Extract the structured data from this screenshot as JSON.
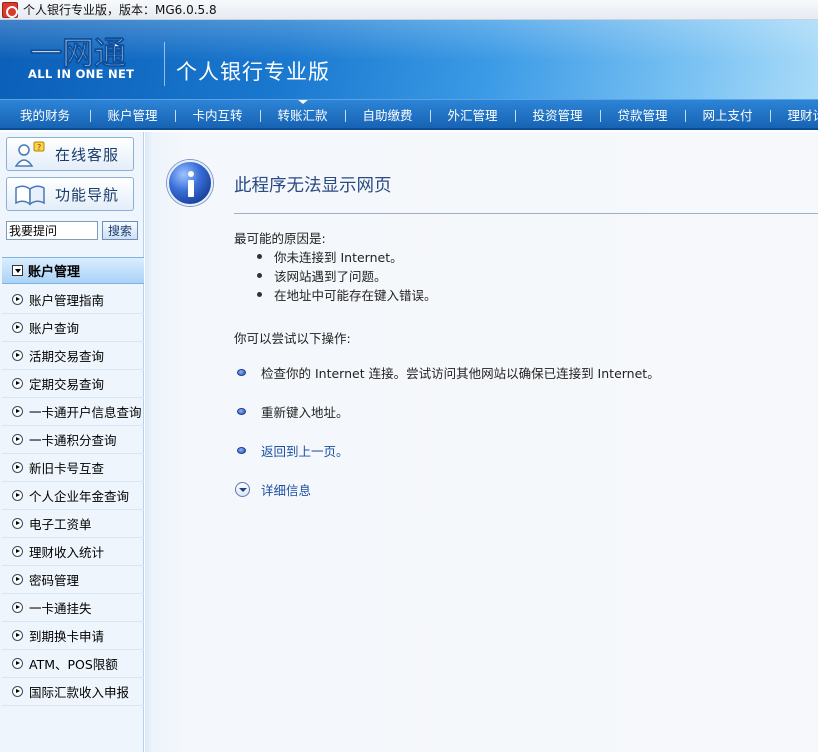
{
  "window": {
    "title": "个人银行专业版，版本：MG6.0.5.8"
  },
  "banner": {
    "logo_text": "一网通",
    "logo_sub": "ALL IN ONE NET",
    "product_name": "个人银行专业版"
  },
  "nav": {
    "items": [
      "我的财务",
      "账户管理",
      "卡内互转",
      "转账汇款",
      "自助缴费",
      "外汇管理",
      "投资管理",
      "贷款管理",
      "网上支付",
      "理财计划"
    ],
    "active_index": 3
  },
  "sidebar": {
    "online_service": "在线客服",
    "function_nav": "功能导航",
    "search_value": "我要提问",
    "search_button": "搜索",
    "menu_title": "账户管理",
    "menu_items": [
      "账户管理指南",
      "账户查询",
      "活期交易查询",
      "定期交易查询",
      "一卡通开户信息查询",
      "一卡通积分查询",
      "新旧卡号互查",
      "个人企业年金查询",
      "电子工资单",
      "理财收入统计",
      "密码管理",
      "一卡通挂失",
      "到期换卡申请",
      "ATM、POS限额",
      "国际汇款收入申报"
    ]
  },
  "error_page": {
    "title": "此程序无法显示网页",
    "causes_title": "最可能的原因是:",
    "causes": [
      "你未连接到 Internet。",
      "该网站遇到了问题。",
      "在地址中可能存在键入错误。"
    ],
    "try_title": "你可以尝试以下操作:",
    "actions": [
      "检查你的 Internet 连接。尝试访问其他网站以确保已连接到 Internet。",
      "重新键入地址。",
      "返回到上一页。"
    ],
    "details": "详细信息"
  },
  "colors": {
    "nav_blue": "#1f6fc4",
    "banner_dark": "#0b5fb8",
    "link_blue": "#1c4fa4"
  }
}
